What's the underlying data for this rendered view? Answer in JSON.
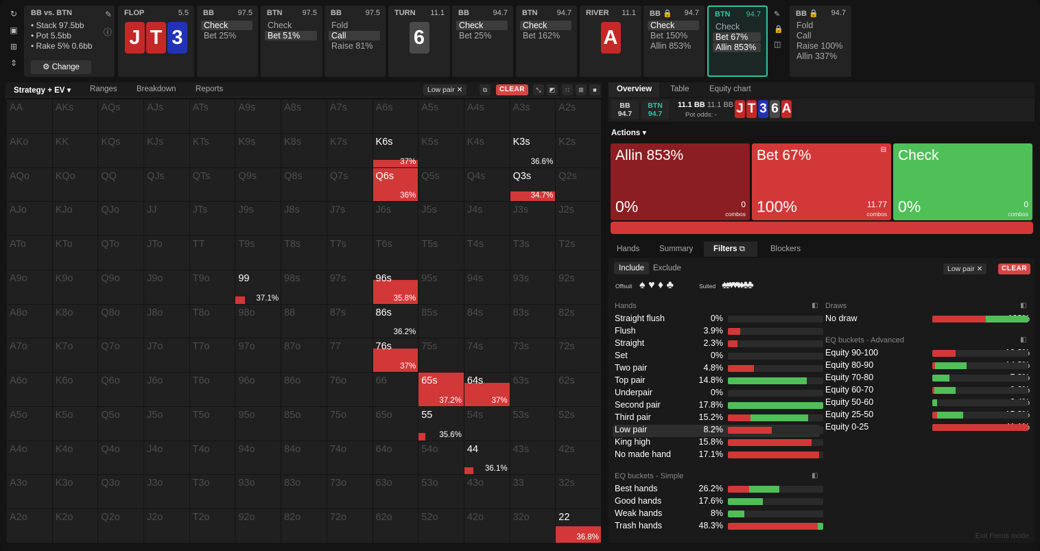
{
  "sidebar_icons": [
    "undo-icon",
    "save-icon",
    "gamepad-icon",
    "collapse-icon"
  ],
  "summary": {
    "title": "BB vs. BTN",
    "lines": [
      "Stack 97.5bb",
      "Pot 5.5bb",
      "Rake 5% 0.6bb"
    ],
    "change": "Change"
  },
  "cards": [
    {
      "id": "flop",
      "head": "FLOP",
      "stat": "5.5",
      "board": [
        {
          "r": "J",
          "c": "r"
        },
        {
          "r": "T",
          "c": "r"
        },
        {
          "r": "3",
          "c": "b"
        }
      ]
    },
    {
      "id": "bb1",
      "head": "BB",
      "stat": "97.5",
      "actions": [
        {
          "t": "Check",
          "sel": true
        },
        {
          "t": "Bet 25%"
        }
      ]
    },
    {
      "id": "btn1",
      "head": "BTN",
      "stat": "97.5",
      "actions": [
        {
          "t": "Check"
        },
        {
          "t": "Bet 51%",
          "sel": true
        }
      ]
    },
    {
      "id": "bb2",
      "head": "BB",
      "stat": "97.5",
      "actions": [
        {
          "t": "Fold"
        },
        {
          "t": "Call",
          "sel": true
        },
        {
          "t": "Raise 81%"
        }
      ]
    },
    {
      "id": "turn",
      "head": "TURN",
      "stat": "11.1",
      "board": [
        {
          "r": "6",
          "c": "g"
        }
      ]
    },
    {
      "id": "bb3",
      "head": "BB",
      "stat": "94.7",
      "actions": [
        {
          "t": "Check",
          "sel": true
        },
        {
          "t": "Bet 25%"
        }
      ]
    },
    {
      "id": "btn2",
      "head": "BTN",
      "stat": "94.7",
      "actions": [
        {
          "t": "Check",
          "sel": true
        },
        {
          "t": "Bet 162%"
        }
      ]
    },
    {
      "id": "river",
      "head": "RIVER",
      "stat": "11.1",
      "board": [
        {
          "r": "A",
          "c": "r"
        }
      ]
    },
    {
      "id": "bb4",
      "head": "BB 🔒",
      "stat": "94.7",
      "actions": [
        {
          "t": "Check",
          "sel": true
        },
        {
          "t": "Bet 150%"
        },
        {
          "t": "Allin 853%"
        }
      ]
    },
    {
      "id": "btn3",
      "head": "BTN",
      "stat": "94.7",
      "active": true,
      "actions": [
        {
          "t": "Check"
        },
        {
          "t": "Bet 67%",
          "sel": true
        },
        {
          "t": "Allin 853%",
          "sel": true
        }
      ]
    },
    {
      "id": "bb5",
      "head": "BB 🔒",
      "stat": "94.7",
      "actions": [
        {
          "t": "Fold"
        },
        {
          "t": "Call"
        },
        {
          "t": "Raise 100%"
        },
        {
          "t": "Allin 337%"
        }
      ]
    }
  ],
  "left_tabs": [
    "Strategy + EV",
    "Ranges",
    "Breakdown",
    "Reports"
  ],
  "filter_chip": "Low pair",
  "clear": "CLEAR",
  "grid": {
    "rows": [
      [
        "AA",
        "AKs",
        "AQs",
        "AJs",
        "ATs",
        "A9s",
        "A8s",
        "A7s",
        "A6s",
        "A5s",
        "A4s",
        "A3s",
        "A2s"
      ],
      [
        "AKo",
        "KK",
        "KQs",
        "KJs",
        "KTs",
        "K9s",
        "K8s",
        "K7s",
        "K6s",
        "K5s",
        "K4s",
        "K3s",
        "K2s"
      ],
      [
        "AQo",
        "KQo",
        "QQ",
        "QJs",
        "QTs",
        "Q9s",
        "Q8s",
        "Q7s",
        "Q6s",
        "Q5s",
        "Q4s",
        "Q3s",
        "Q2s"
      ],
      [
        "AJo",
        "KJo",
        "QJo",
        "JJ",
        "JTs",
        "J9s",
        "J8s",
        "J7s",
        "J6s",
        "J5s",
        "J4s",
        "J3s",
        "J2s"
      ],
      [
        "ATo",
        "KTo",
        "QTo",
        "JTo",
        "TT",
        "T9s",
        "T8s",
        "T7s",
        "T6s",
        "T5s",
        "T4s",
        "T3s",
        "T2s"
      ],
      [
        "A9o",
        "K9o",
        "Q9o",
        "J9o",
        "T9o",
        "99",
        "98s",
        "97s",
        "96s",
        "95s",
        "94s",
        "93s",
        "92s"
      ],
      [
        "A8o",
        "K8o",
        "Q8o",
        "J8o",
        "T8o",
        "98o",
        "88",
        "87s",
        "86s",
        "85s",
        "84s",
        "83s",
        "82s"
      ],
      [
        "A7o",
        "K7o",
        "Q7o",
        "J7o",
        "T7o",
        "97o",
        "87o",
        "77",
        "76s",
        "75s",
        "74s",
        "73s",
        "72s"
      ],
      [
        "A6o",
        "K6o",
        "Q6o",
        "J6o",
        "T6o",
        "96o",
        "86o",
        "76o",
        "66",
        "65s",
        "64s",
        "63s",
        "62s"
      ],
      [
        "A5o",
        "K5o",
        "Q5o",
        "J5o",
        "T5o",
        "95o",
        "85o",
        "75o",
        "65o",
        "55",
        "54s",
        "53s",
        "52s"
      ],
      [
        "A4o",
        "K4o",
        "Q4o",
        "J4o",
        "T4o",
        "94o",
        "84o",
        "74o",
        "64o",
        "54o",
        "44",
        "43s",
        "42s"
      ],
      [
        "A3o",
        "K3o",
        "Q3o",
        "J3o",
        "T3o",
        "93o",
        "83o",
        "73o",
        "63o",
        "53o",
        "43o",
        "33",
        "32s"
      ],
      [
        "A2o",
        "K2o",
        "Q2o",
        "J2o",
        "T2o",
        "92o",
        "82o",
        "72o",
        "62o",
        "52o",
        "42o",
        "32o",
        "22"
      ]
    ],
    "active": [
      {
        "hand": "K6s",
        "pct": "37%",
        "fill": 1.0,
        "freq": 0.25
      },
      {
        "hand": "K3s",
        "pct": "36.6%",
        "fill": 0,
        "freq": 0
      },
      {
        "hand": "Q6s",
        "pct": "36%",
        "fill": 1.0,
        "freq": 1.0
      },
      {
        "hand": "Q3s",
        "pct": "34.7%",
        "fill": 1.0,
        "freq": 0.3
      },
      {
        "hand": "99",
        "pct": "37.1%",
        "fill": 1.0,
        "freq": 0.2
      },
      {
        "hand": "96s",
        "pct": "35.8%",
        "fill": 1.0,
        "freq": 0.7
      },
      {
        "hand": "86s",
        "pct": "36.2%",
        "fill": 0,
        "freq": 0
      },
      {
        "hand": "76s",
        "pct": "37%",
        "fill": 1.0,
        "freq": 0.7
      },
      {
        "hand": "65s",
        "pct": "37.2%",
        "fill": 1.0,
        "freq": 0.95
      },
      {
        "hand": "64s",
        "pct": "37%",
        "fill": 1.0,
        "freq": 0.7
      },
      {
        "hand": "55",
        "pct": "35.6%",
        "fill": 1.0,
        "freq": 0.15
      },
      {
        "hand": "44",
        "pct": "36.1%",
        "fill": 1.0,
        "freq": 0.2
      },
      {
        "hand": "22",
        "pct": "36.8%",
        "fill": 1.0,
        "freq": 0.5
      }
    ]
  },
  "right_tabs": [
    "Overview",
    "Table",
    "Equity chart"
  ],
  "board_info": {
    "bb": "BB",
    "bb_stack": "94.7",
    "btn": "BTN",
    "btn_stack": "94.7",
    "pot1": "11.1 BB",
    "pot2": "11.1 BB",
    "pot_odds": "Pot odds:  -",
    "board": [
      {
        "r": "J",
        "c": "r"
      },
      {
        "r": "T",
        "c": "r"
      },
      {
        "r": "3",
        "c": "b"
      },
      {
        "r": "6",
        "c": "g"
      },
      {
        "r": "A",
        "c": "r"
      }
    ]
  },
  "actions_label": "Actions",
  "action_boxes": [
    {
      "title": "Allin 853%",
      "pct": "0%",
      "combos": "0",
      "combos_label": "combos",
      "color": "#8b1e22"
    },
    {
      "title": "Bet 67%",
      "pct": "100%",
      "combos": "11.77",
      "combos_label": "combos",
      "color": "#d23838"
    },
    {
      "title": "Check",
      "pct": "0%",
      "combos": "0",
      "combos_label": "combos",
      "color": "#4fbf58"
    }
  ],
  "sub_tabs": [
    "Hands",
    "Summary",
    "Filters",
    "Blockers"
  ],
  "filters": {
    "include": "Include",
    "exclude": "Exclude",
    "offsuit": "Offsuit",
    "suited": "Suited",
    "hands_title": "Hands",
    "draws_title": "Draws",
    "eqsimple_title": "EQ buckets - Simple",
    "eqadv_title": "EQ buckets - Advanced",
    "hands": [
      {
        "l": "Straight flush",
        "v": "0%",
        "r": 0,
        "g": 0
      },
      {
        "l": "Flush",
        "v": "3.9%",
        "r": 0.13,
        "g": 0
      },
      {
        "l": "Straight",
        "v": "2.3%",
        "r": 0.1,
        "g": 0
      },
      {
        "l": "Set",
        "v": "0%",
        "r": 0,
        "g": 0
      },
      {
        "l": "Two pair",
        "v": "4.8%",
        "r": 0.27,
        "g": 0
      },
      {
        "l": "Top pair",
        "v": "14.8%",
        "r": 0,
        "g": 0.83
      },
      {
        "l": "Underpair",
        "v": "0%",
        "r": 0,
        "g": 0
      },
      {
        "l": "Second pair",
        "v": "17.8%",
        "r": 0,
        "g": 1.0
      },
      {
        "l": "Third pair",
        "v": "15.2%",
        "r": 0.24,
        "g": 0.6
      },
      {
        "l": "Low pair",
        "v": "8.2%",
        "r": 0.46,
        "g": 0
      },
      {
        "l": "King high",
        "v": "15.8%",
        "r": 0.88,
        "g": 0
      },
      {
        "l": "No made hand",
        "v": "17.1%",
        "r": 0.96,
        "g": 0
      }
    ],
    "eq_simple": [
      {
        "l": "Best hands",
        "v": "26.2%",
        "r": 0.22,
        "g": 0.32
      },
      {
        "l": "Good hands",
        "v": "17.6%",
        "r": 0,
        "g": 0.37
      },
      {
        "l": "Weak hands",
        "v": "8%",
        "r": 0,
        "g": 0.17
      },
      {
        "l": "Trash hands",
        "v": "48.3%",
        "r": 0.94,
        "g": 0.06
      }
    ],
    "draws": [
      {
        "l": "No draw",
        "v": "100%",
        "r": 0.56,
        "g": 0.44
      }
    ],
    "eq_adv": [
      {
        "l": "Equity 90-100",
        "v": "10.2%",
        "r": 0.24,
        "g": 0
      },
      {
        "l": "Equity 80-90",
        "v": "14.3%",
        "r": 0.03,
        "g": 0.33
      },
      {
        "l": "Equity 70-80",
        "v": "7.3%",
        "r": 0,
        "g": 0.18
      },
      {
        "l": "Equity 60-70",
        "v": "9.6%",
        "r": 0.02,
        "g": 0.22
      },
      {
        "l": "Equity 50-60",
        "v": "2.4%",
        "r": 0,
        "g": 0.05
      },
      {
        "l": "Equity 25-50",
        "v": "15.2%",
        "r": 0.05,
        "g": 0.27
      },
      {
        "l": "Equity 0-25",
        "v": "41.1%",
        "r": 1.0,
        "g": 0
      }
    ]
  },
  "exit_focus": "Exit Focus mode"
}
